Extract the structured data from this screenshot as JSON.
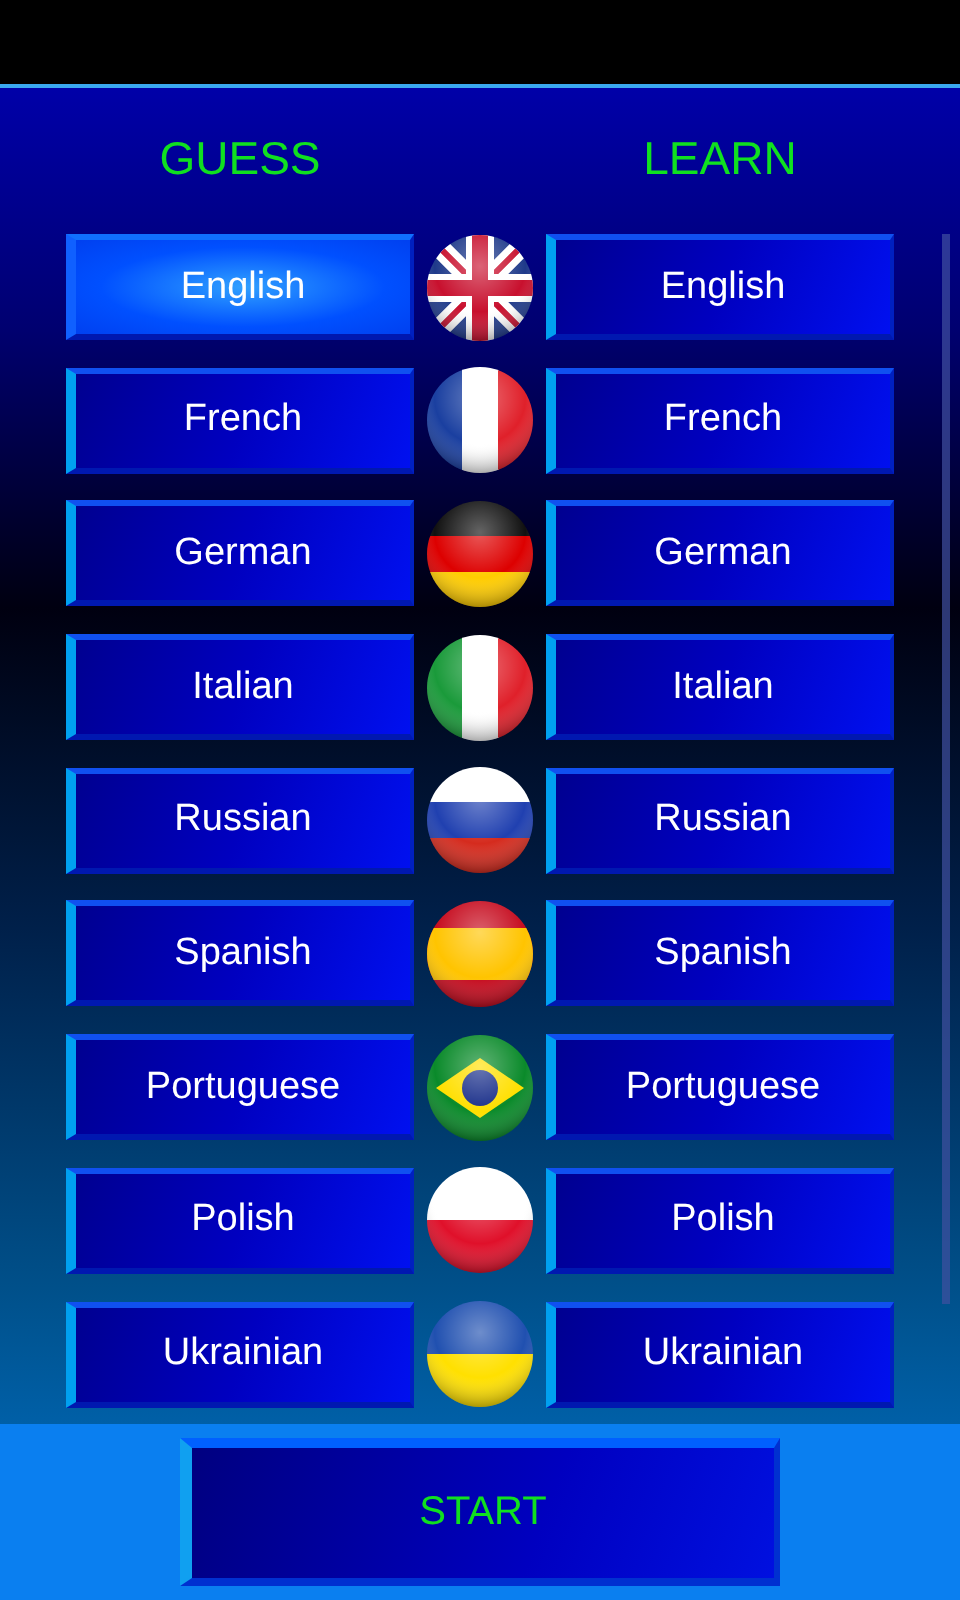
{
  "headers": {
    "guess": "GUESS",
    "learn": "LEARN"
  },
  "rows": [
    {
      "kind": "uk",
      "guess": {
        "label": "English",
        "selected": true
      },
      "learn": {
        "label": "English",
        "selected": false
      }
    },
    {
      "kind": "france",
      "guess": {
        "label": "French",
        "selected": false
      },
      "learn": {
        "label": "French",
        "selected": false
      }
    },
    {
      "kind": "germany",
      "guess": {
        "label": "German",
        "selected": false
      },
      "learn": {
        "label": "German",
        "selected": false
      }
    },
    {
      "kind": "italy",
      "guess": {
        "label": "Italian",
        "selected": false
      },
      "learn": {
        "label": "Italian",
        "selected": false
      }
    },
    {
      "kind": "russia",
      "guess": {
        "label": "Russian",
        "selected": false
      },
      "learn": {
        "label": "Russian",
        "selected": false
      }
    },
    {
      "kind": "spain",
      "guess": {
        "label": "Spanish",
        "selected": false
      },
      "learn": {
        "label": "Spanish",
        "selected": false
      }
    },
    {
      "kind": "brazil",
      "guess": {
        "label": "Portuguese",
        "selected": false
      },
      "learn": {
        "label": "Portuguese",
        "selected": false
      }
    },
    {
      "kind": "poland",
      "guess": {
        "label": "Polish",
        "selected": false
      },
      "learn": {
        "label": "Polish",
        "selected": false
      }
    },
    {
      "kind": "ukraine",
      "guess": {
        "label": "Ukrainian",
        "selected": false
      },
      "learn": {
        "label": "Ukrainian",
        "selected": false
      }
    }
  ],
  "start_button": "START"
}
